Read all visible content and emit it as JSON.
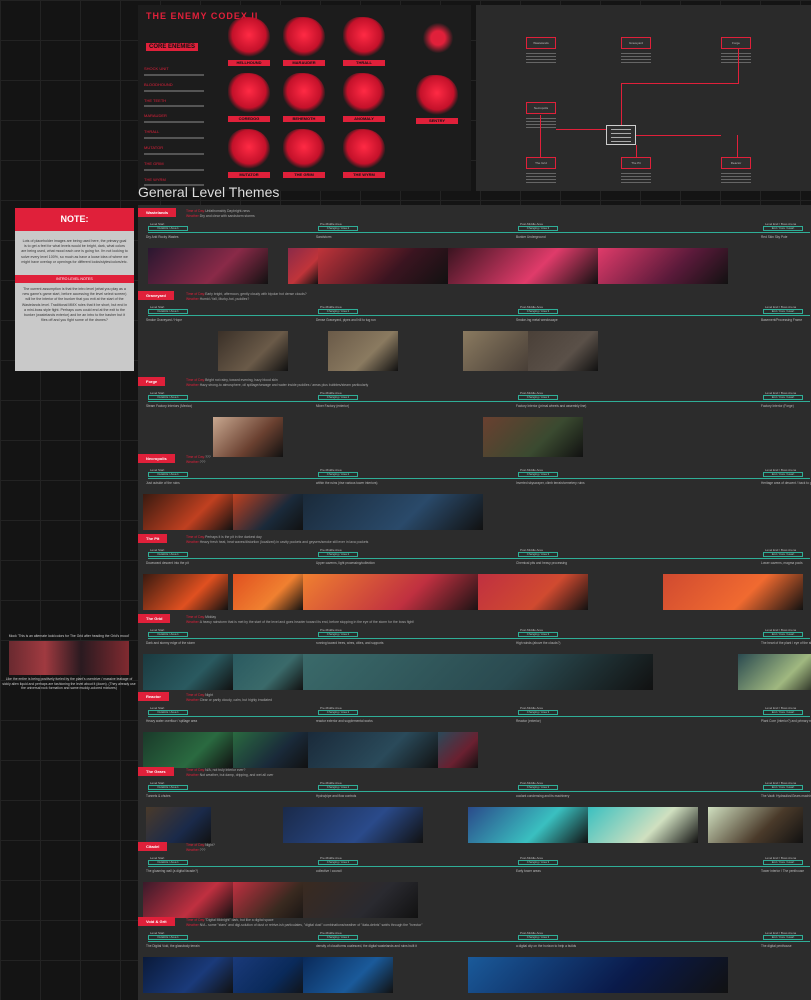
{
  "section_title": "General Level Themes",
  "poster": {
    "title": "THE ENEMY CODEX II",
    "subtitle": "CORE ENEMIES",
    "legend": [
      "SHOCK UNIT",
      "BLOODHOUND",
      "THE TEETH",
      "MARAUDER",
      "THRALL",
      "MUTATOR",
      "THE GRIM",
      "THE WYRM"
    ],
    "labels": [
      "HELLHOUND",
      "MARAUDER",
      "THRALL",
      "COREDOG",
      "BEHEMOTH",
      "ANOMALY",
      "MUTATOR",
      "THE GRIM",
      "THE WYRM",
      "SENTRY"
    ]
  },
  "flowchart": {
    "nodes": [
      "Wastelands",
      "Graveyard",
      "Forge",
      "Necropolis",
      "The Grid",
      "The Pit",
      "Reactor"
    ]
  },
  "note": {
    "title": "NOTE:",
    "body": "Lots of placeholder images are being used here, the primary goal is to get a feel for what levels would be bright, dark, what colors are being used, what mood each one is going for. I'm not looking to solve every level 100%, so much as have a loose idea of where we might have overlap or openings for different looks/styles/colors/etc.",
    "sub_title": "INTRO LEVEL NOTES",
    "sub_body": "The current assumption is that the intro level (what you play as a new game's game start, before accessing the level select screen) will be the interior of the bunker that you exit at the start of the Wastelands level. Traditional MMX rules that it be short, but end in a mini-boss style fight. Perhaps ours could end at the exit to the bunker (wastelands exterior) and be an intro to the basher but it flies off and you fight some of the drones?"
  },
  "side_note": {
    "top": "Mock 'This is an alternate look/colors for The Grid after heading the Grid's mood'",
    "bottom": "Like the entire is being positively fueled by the plant's overdrive / massive leakage of sickly alien liquid and perhaps are fashioning the level about it (down). (They already use the universal rock formation and same muddy-colored mixtures)"
  },
  "stage_labels": [
    "Level Start",
    "Pre-Middle Area",
    "Post-Middle Area",
    "Level End / Boss Arena"
  ],
  "stage_ticks": [
    "Outskirts / Area 1",
    "Changing / Area 2",
    "Changing / Area 3",
    "End / Core / Heart"
  ],
  "tod_label": "Time of Day:",
  "weather_label": "Weather:",
  "levels": [
    {
      "name": "Wastelands",
      "tod": "Unfathomably Daybright-ness",
      "weather": "Dry and clear with sandstorm storms",
      "areas": [
        "Dry Arid Rocky Wastes",
        "Sandstorm",
        "Bunker Underground",
        "Red Skin Sky Pole"
      ],
      "colors": [
        "#2a1730",
        "#8a2a48",
        "#c0343a",
        "#3a1420",
        "#e03b6a",
        "#5a1a3a",
        "#9e2a55",
        "#c44068"
      ]
    },
    {
      "name": "Graveyard",
      "tod": "Early bright, afternoon, gently cloudy with bipolar hot dense clouds?",
      "weather": "Humid / fall, Murky-hot, puddles?",
      "areas": [
        "Smoke Graveyard / Hope",
        "Dense Graveyard, pipes and hill to tug run",
        "Smoke-ing metal wreckscape",
        "Basement/Processing Frame"
      ],
      "colors": [
        "#3a3028",
        "#6a5a48",
        "#8a7a60",
        "#4a4038",
        "#5a5048",
        "#6a5a50"
      ]
    },
    {
      "name": "Forge",
      "tod": "Bright not rainy, toward evening, hazy blood skin",
      "weather": "Hazy strong-to atmosphere, oil spillage/sewage and water inside puddles / areas plus bubbles/steam particularly",
      "areas": [
        "Steam Factory Interiors (Mexico)",
        "Mixer Factory (exterior)",
        "Factory Interior (primal wheels and assembly line)",
        "Factory Interior (Forge)"
      ],
      "colors": [
        "#c8a890",
        "#6a4030",
        "#3a4a30"
      ]
    },
    {
      "name": "Necropolis",
      "tod": "???",
      "weather": "???",
      "areas": [
        "Just outside of the ruins",
        "within the ruins (rise various tower interiors)",
        "Inverted skyscraper, climb terrain/cemetery ruins",
        "Heritage area of descent / back to ground level for fight"
      ],
      "colors": [
        "#3a1a10",
        "#c04020",
        "#1a2a3a",
        "#2a4a6a",
        "#3a5070"
      ]
    },
    {
      "name": "The Pit",
      "tod": "Perhaps it is the pit in the darkest day",
      "weather": "Heavy fresh heat, heat waves/distortion (localized) in cavity pockets and geysers/smoke still ever in lava pockets",
      "areas": [
        "Downward descent into the pit",
        "Upper caverns, light processing/collection",
        "Chemical pits and heavy processing",
        "Lower caverns, magma pools"
      ],
      "colors": [
        "#3a1a10",
        "#e05020",
        "#f08030",
        "#c03040",
        "#d04a30",
        "#f06a30"
      ]
    },
    {
      "name": "The Grid",
      "tod": "Midday",
      "weather": "A heavy rainstorm that is met by the start of the level and goes heavier toward its end, before stopping in the eye of the storm for the boss fight!",
      "areas": [
        "Dark and stormy edge of the storm",
        "running toward trees, wires, cities, and supports",
        "High winds (above the clouds?)",
        "The heart of the plant / eye of the storm"
      ],
      "colors": [
        "#1a3a40",
        "#2a5a60",
        "#3a6a6a",
        "#2a4a50",
        "#a0b880"
      ]
    },
    {
      "name": "Reactor",
      "tod": "Night",
      "weather": "Clear or partly cloudy, calm, but highly irradiated",
      "areas": [
        "Heavy water overflow / spillage area",
        "reactor exterior and supplemental works",
        "Reactor (exterior)",
        "Plant Core (interior?) and primary reactor core"
      ],
      "colors": [
        "#1a3a2a",
        "#2a6a40",
        "#1a2a3a",
        "#2a4a5a",
        "#6a2030"
      ]
    },
    {
      "name": "The Gears",
      "tod": "N/A, not truly interior ever?",
      "weather": "Not weather, but damp, dripping, and wet all over",
      "areas": [
        "Tunnels & chutes",
        "Hydro/pipe and flow controls",
        "coolant condensing and its machinery",
        "The Vault: Hydraulics/Gears machinery/Elevator flow"
      ],
      "colors": [
        "#4a3a2a",
        "#1a2a4a",
        "#2a4a8a",
        "#3ac0c0",
        "#d0e0c0"
      ]
    },
    {
      "name": "Citadel",
      "tod": "Night?",
      "weather": "???",
      "areas": [
        "The gloaming wall (a digital facade?)",
        "collective / council",
        "Early tower areas",
        "Tower interior / The penthouse"
      ],
      "colors": [
        "#3a1a2a",
        "#c03040",
        "#3a2a20",
        "#2a2a30"
      ]
    },
    {
      "name": "Void & Grit",
      "tod": "\"Digital Midnight\" dark, but like a digital space",
      "weather": "N/A - some \"stars\" and digi-solution of dust or retrive-ish particulates, \"digital dust\" combinations/weather of \"data-debris\" swirls through the \"hvector\"",
      "areas": [
        "The Digital Void, the glassbody terrain",
        "density of cloudforms coalesced, the digital wastelands and ruins built it",
        "a digital city on the horizon to help a builds",
        "The digital penthouse"
      ],
      "colors": [
        "#0a1a3a",
        "#1a3a7a",
        "#0a2a5a",
        "#1a5a9a",
        "#0a1a4a",
        "#2a6ac0",
        "#0a2a6a"
      ]
    }
  ]
}
